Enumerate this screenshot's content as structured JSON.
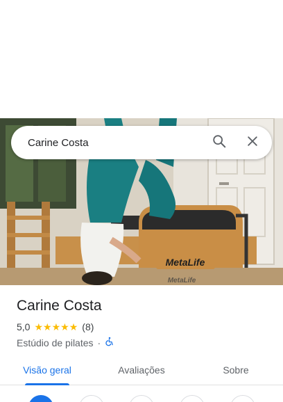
{
  "search": {
    "value": "Carine Costa",
    "search_icon": "search-icon",
    "close_icon": "close-icon"
  },
  "hero": {
    "logo_text": "MetaLife",
    "logo_text_reflection": "MetaLife"
  },
  "place": {
    "name": "Carine Costa",
    "rating": "5,0",
    "stars": 5,
    "review_count": "(8)",
    "category": "Estúdio de pilates",
    "separator": "·",
    "accessibility_icon": "wheelchair-icon"
  },
  "tabs": [
    {
      "label": "Visão geral",
      "active": true
    },
    {
      "label": "Avaliações",
      "active": false
    },
    {
      "label": "Sobre",
      "active": false
    }
  ],
  "colors": {
    "accent": "#1a73e8",
    "star": "#fbbc04",
    "text_primary": "#202124",
    "text_secondary": "#5f6368"
  }
}
